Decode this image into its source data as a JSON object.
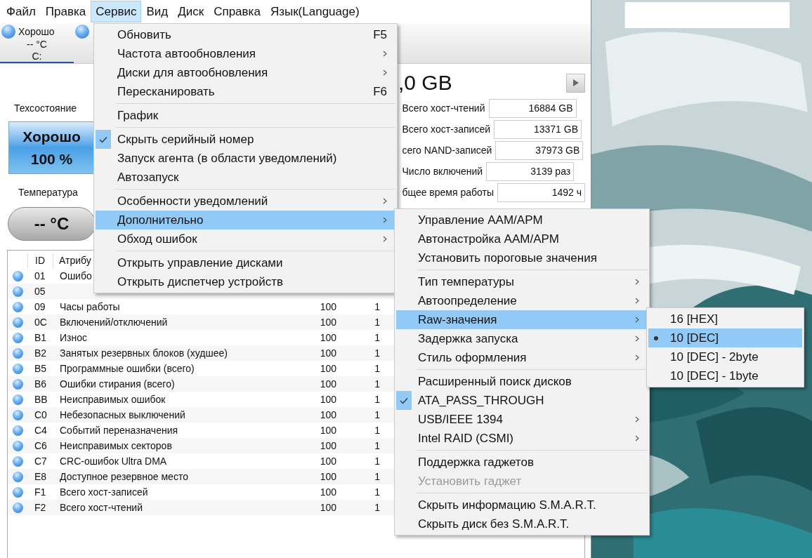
{
  "menu_bar": [
    {
      "label": "Файл",
      "selected": false
    },
    {
      "label": "Правка",
      "selected": false
    },
    {
      "label": "Сервис",
      "selected": true
    },
    {
      "label": "Вид",
      "selected": false
    },
    {
      "label": "Диск",
      "selected": false
    },
    {
      "label": "Справка",
      "selected": false
    },
    {
      "label": "Язык(Language)",
      "selected": false
    }
  ],
  "disk_tabs": [
    {
      "status": "Хорошо",
      "temperature": "-- °C",
      "drive": "C:",
      "selected": true
    },
    {
      "selected": false
    }
  ],
  "health": {
    "label": "Техсостояние",
    "status": "Хорошо",
    "percent": "100 %"
  },
  "temperature": {
    "label": "Температура",
    "value": "-- °C"
  },
  "capacity": ",0 GB",
  "info": [
    {
      "label": "Всего хост-чтений",
      "value": "16884 GB"
    },
    {
      "label": "Всего хост-записей",
      "value": "13371 GB"
    },
    {
      "label": "сего NAND-записей",
      "value": "37973 GB"
    },
    {
      "label": "Число включений",
      "value": "3139 раз"
    },
    {
      "label": "бщее время работы",
      "value": "1492 ч"
    }
  ],
  "table": {
    "columns": [
      "ID",
      "Атрибу"
    ],
    "rows": [
      {
        "id": "01",
        "name": "Ошибо"
      },
      {
        "id": "05"
      },
      {
        "id": "09",
        "name": "Часы работы",
        "current": "100",
        "worst": "1"
      },
      {
        "id": "0C",
        "name": "Включений/отключений",
        "current": "100",
        "worst": "1"
      },
      {
        "id": "B1",
        "name": "Износ",
        "current": "100",
        "worst": "1"
      },
      {
        "id": "B2",
        "name": "Занятых резервных блоков (худшее)",
        "current": "100",
        "worst": "1"
      },
      {
        "id": "B5",
        "name": "Программные ошибки (всего)",
        "current": "100",
        "worst": "1"
      },
      {
        "id": "B6",
        "name": "Ошибки стирания (всего)",
        "current": "100",
        "worst": "1"
      },
      {
        "id": "BB",
        "name": "Неисправимых ошибок",
        "current": "100",
        "worst": "1"
      },
      {
        "id": "C0",
        "name": "Небезопасных выключений",
        "current": "100",
        "worst": "1"
      },
      {
        "id": "C4",
        "name": "Событий переназначения",
        "current": "100",
        "worst": "1"
      },
      {
        "id": "C6",
        "name": "Неисправимых секторов",
        "current": "100",
        "worst": "1"
      },
      {
        "id": "C7",
        "name": "CRC-ошибок Ultra DMA",
        "current": "100",
        "worst": "1"
      },
      {
        "id": "E8",
        "name": "Доступное резервное место",
        "current": "100",
        "worst": "1"
      },
      {
        "id": "F1",
        "name": "Всего хост-записей",
        "current": "100",
        "worst": "1"
      },
      {
        "id": "F2",
        "name": "Всего хост-чтений",
        "current": "100",
        "worst": "1"
      }
    ]
  },
  "service_menu": [
    {
      "kind": "item",
      "label": "Обновить",
      "shortcut": "F5",
      "submenu": false,
      "checked": false,
      "selected": false,
      "disabled": false
    },
    {
      "kind": "item",
      "label": "Частота автообновления",
      "submenu": true,
      "checked": false,
      "selected": false,
      "disabled": false
    },
    {
      "kind": "item",
      "label": "Диски для автообновления",
      "submenu": true,
      "checked": false,
      "selected": false,
      "disabled": false
    },
    {
      "kind": "item",
      "label": "Пересканировать",
      "shortcut": "F6",
      "submenu": false,
      "checked": false,
      "selected": false,
      "disabled": false
    },
    {
      "kind": "separator"
    },
    {
      "kind": "item",
      "label": "График",
      "submenu": false,
      "checked": false,
      "selected": false,
      "disabled": false
    },
    {
      "kind": "separator"
    },
    {
      "kind": "item",
      "label": "Скрыть серийный номер",
      "submenu": false,
      "checked": true,
      "selected": false,
      "disabled": false
    },
    {
      "kind": "item",
      "label": "Запуск агента (в области уведомлений)",
      "submenu": false,
      "checked": false,
      "selected": false,
      "disabled": false
    },
    {
      "kind": "item",
      "label": "Автозапуск",
      "submenu": false,
      "checked": false,
      "selected": false,
      "disabled": false
    },
    {
      "kind": "separator"
    },
    {
      "kind": "item",
      "label": "Особенности уведомлений",
      "submenu": true,
      "checked": false,
      "selected": false,
      "disabled": false
    },
    {
      "kind": "item",
      "label": "Дополнительно",
      "submenu": true,
      "checked": false,
      "selected": true,
      "disabled": false
    },
    {
      "kind": "item",
      "label": "Обход ошибок",
      "submenu": true,
      "checked": false,
      "selected": false,
      "disabled": false
    },
    {
      "kind": "separator"
    },
    {
      "kind": "item",
      "label": "Открыть управление дисками",
      "submenu": false,
      "checked": false,
      "selected": false,
      "disabled": false
    },
    {
      "kind": "item",
      "label": "Открыть диспетчер устройств",
      "submenu": false,
      "checked": false,
      "selected": false,
      "disabled": false
    }
  ],
  "advanced_submenu": [
    {
      "kind": "item",
      "label": "Управление AAM/APM",
      "submenu": false,
      "checked": false,
      "selected": false,
      "disabled": false
    },
    {
      "kind": "item",
      "label": "Автонастройка AAM/APM",
      "submenu": false,
      "checked": false,
      "selected": false,
      "disabled": false
    },
    {
      "kind": "item",
      "label": "Установить пороговые значения",
      "submenu": false,
      "checked": false,
      "selected": false,
      "disabled": false
    },
    {
      "kind": "separator"
    },
    {
      "kind": "item",
      "label": "Тип температуры",
      "submenu": true,
      "checked": false,
      "selected": false,
      "disabled": false
    },
    {
      "kind": "item",
      "label": "Автоопределение",
      "submenu": true,
      "checked": false,
      "selected": false,
      "disabled": false
    },
    {
      "kind": "item",
      "label": "Raw-значения",
      "submenu": true,
      "checked": false,
      "selected": true,
      "disabled": false
    },
    {
      "kind": "item",
      "label": "Задержка запуска",
      "submenu": true,
      "checked": false,
      "selected": false,
      "disabled": false
    },
    {
      "kind": "item",
      "label": "Стиль оформления",
      "submenu": true,
      "checked": false,
      "selected": false,
      "disabled": false
    },
    {
      "kind": "separator"
    },
    {
      "kind": "item",
      "label": "Расширенный поиск дисков",
      "submenu": false,
      "checked": false,
      "selected": false,
      "disabled": false
    },
    {
      "kind": "item",
      "label": "ATA_PASS_THROUGH",
      "submenu": false,
      "checked": true,
      "selected": false,
      "disabled": false
    },
    {
      "kind": "item",
      "label": "USB/IEEE 1394",
      "submenu": true,
      "checked": false,
      "selected": false,
      "disabled": false
    },
    {
      "kind": "item",
      "label": "Intel RAID (CSMI)",
      "submenu": true,
      "checked": false,
      "selected": false,
      "disabled": false
    },
    {
      "kind": "separator"
    },
    {
      "kind": "item",
      "label": "Поддержка гаджетов",
      "submenu": false,
      "checked": false,
      "selected": false,
      "disabled": false
    },
    {
      "kind": "item",
      "label": "Установить гаджет",
      "submenu": false,
      "checked": false,
      "selected": false,
      "disabled": true
    },
    {
      "kind": "separator"
    },
    {
      "kind": "item",
      "label": "Скрыть информацию S.M.A.R.T.",
      "submenu": false,
      "checked": false,
      "selected": false,
      "disabled": false
    },
    {
      "kind": "item",
      "label": "Скрыть диск без S.M.A.R.T.",
      "submenu": false,
      "checked": false,
      "selected": false,
      "disabled": false
    }
  ],
  "raw_submenu": [
    {
      "kind": "radio",
      "label": "16 [HEX]",
      "checked": false,
      "selected": false
    },
    {
      "kind": "radio",
      "label": "10 [DEC]",
      "checked": true,
      "selected": true
    },
    {
      "kind": "radio",
      "label": "10 [DEC] - 2byte",
      "checked": false,
      "selected": false
    },
    {
      "kind": "radio",
      "label": "10 [DEC] - 1byte",
      "checked": false,
      "selected": false
    }
  ]
}
